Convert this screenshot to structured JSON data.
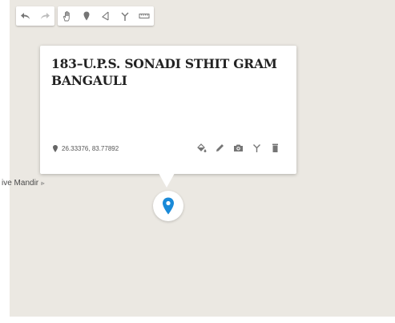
{
  "toolbar": {
    "groups": [
      [
        {
          "icon": "undo-icon"
        },
        {
          "icon": "redo-icon"
        }
      ],
      [
        {
          "icon": "hand-pan-icon"
        },
        {
          "icon": "add-marker-icon"
        },
        {
          "icon": "draw-line-icon"
        },
        {
          "icon": "directions-icon"
        },
        {
          "icon": "ruler-icon"
        }
      ]
    ]
  },
  "info_window": {
    "title": "183–U.P.S. SONADI STHIT GRAM BANGAULI",
    "coordinates": "26.33376, 83.77892",
    "actions": [
      "fill-style-icon",
      "edit-pencil-icon",
      "camera-icon",
      "directions-icon",
      "delete-trash-icon"
    ]
  },
  "map": {
    "place_label": "ive Mandir",
    "place_label_suffix": "⪢"
  },
  "colors": {
    "map_background": "#ebe8e2",
    "marker_blue": "#1a8ad8",
    "icon_gray": "#757575"
  }
}
